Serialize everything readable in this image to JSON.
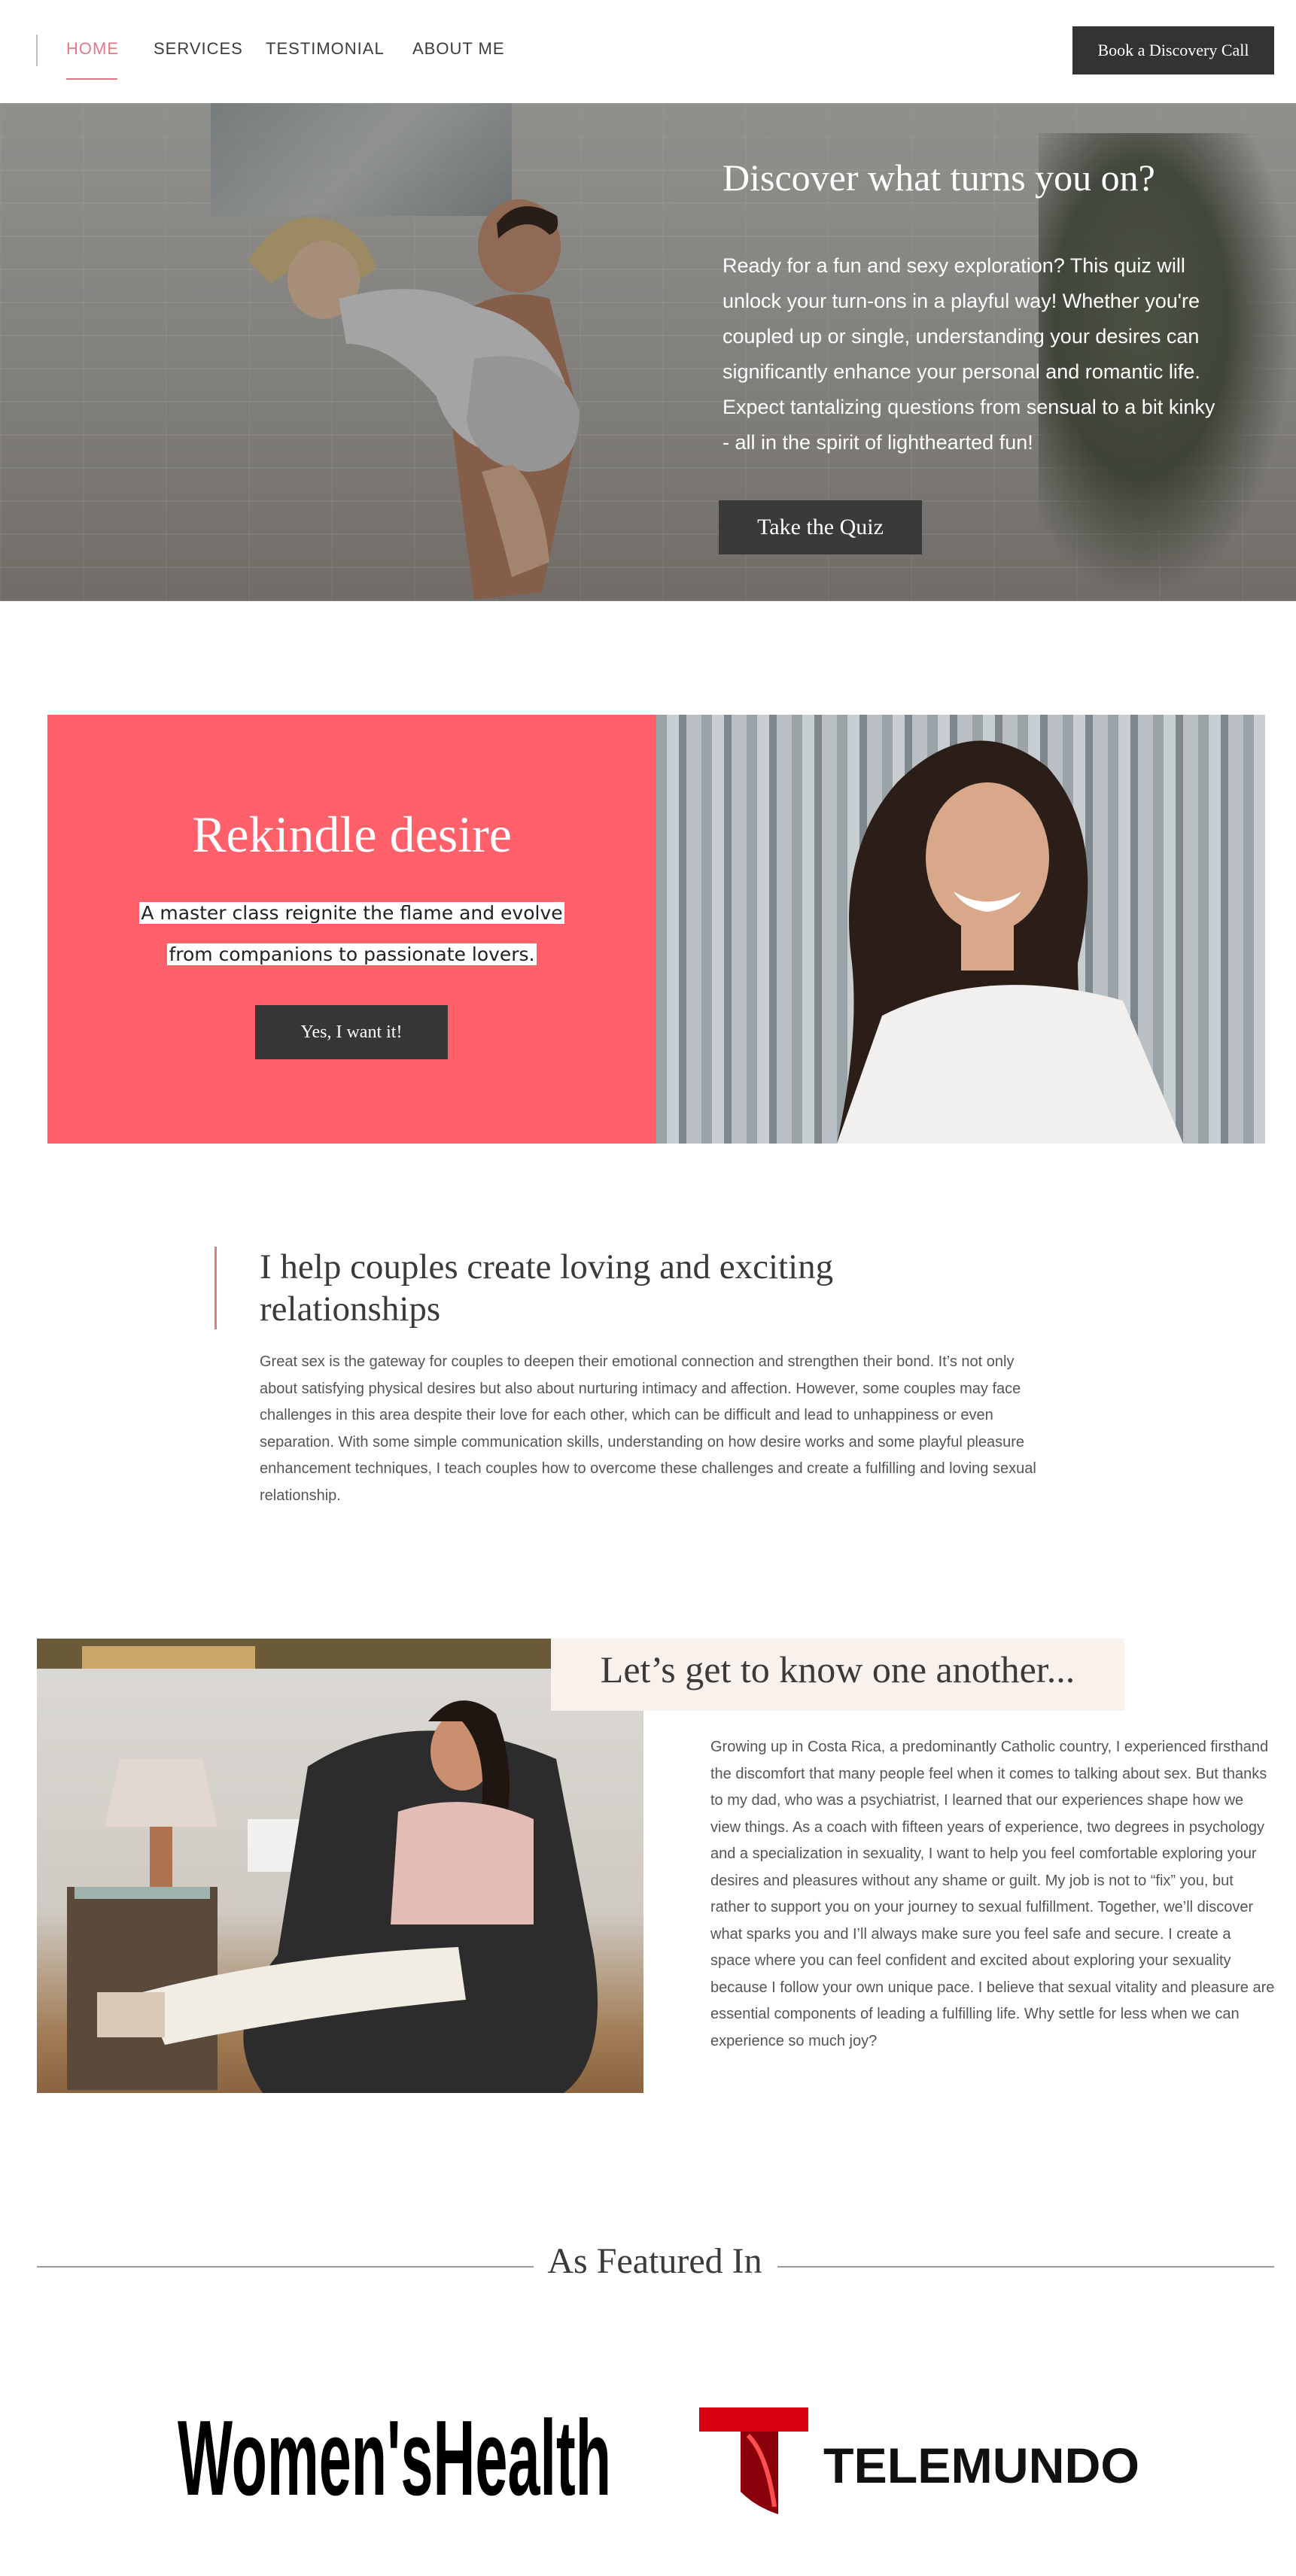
{
  "nav": {
    "links": [
      "HOME",
      "SERVICES",
      "TESTIMONIAL",
      "ABOUT ME"
    ],
    "cta": "Book a Discovery Call"
  },
  "hero": {
    "title": "Discover what turns you on?",
    "text": "Ready for a fun and sexy exploration? This quiz will unlock your turn-ons in a playful way! Whether you're coupled up or single, understanding your desires can significantly enhance your personal and romantic life. Expect tantalizing questions from sensual to a bit kinky - all in the spirit of lighthearted fun!",
    "button": "Take the Quiz"
  },
  "rekindle": {
    "title": "Rekindle desire",
    "subtitle_line1": "A master class reignite the flame and evolve",
    "subtitle_line2": "from companions to passionate lovers.",
    "button": "Yes, I want it!",
    "accent_color": "#ff606a"
  },
  "help": {
    "title": "I help couples create loving and exciting relationships",
    "text": "Great sex is the gateway for couples to deepen their emotional connection and strengthen their bond. It’s not only about satisfying physical desires but also about nurturing intimacy and affection. However, some couples may face challenges in this area despite their love for each other, which can be difficult and lead to unhappiness or even separation. With some simple communication skills, understanding on how desire works and some playful pleasure enhancement techniques, I teach couples how to overcome these challenges and create a fulfilling and loving sexual relationship."
  },
  "know": {
    "title": "Let’s get to know one another...",
    "text": "Growing up in Costa Rica, a predominantly Catholic country, I experienced firsthand the discomfort that many people feel when it comes to talking about sex. But thanks to my dad, who was a psychiatrist, I learned that our experiences shape how we view things. As a coach with fifteen years of experience, two degrees in psychology and a specialization in sexuality, I want to help you feel comfortable exploring your desires and pleasures without any shame or guilt. My job is not to “fix” you, but rather to support you on your journey to sexual fulfillment. Together, we’ll discover what sparks you and I’ll always make sure you feel safe and secure. I create a space where you can feel confident and excited about exploring your sexuality because I follow your own unique pace. I believe that sexual vitality and pleasure are essential components of leading a fulfilling life. Why settle for less when we can experience so much joy?"
  },
  "featured": {
    "title": "As Featured In",
    "logos": [
      "Women'sHealth",
      "TELEMUNDO"
    ]
  },
  "colors": {
    "nav_active": "#e07a86",
    "button_dark": "#333333"
  }
}
